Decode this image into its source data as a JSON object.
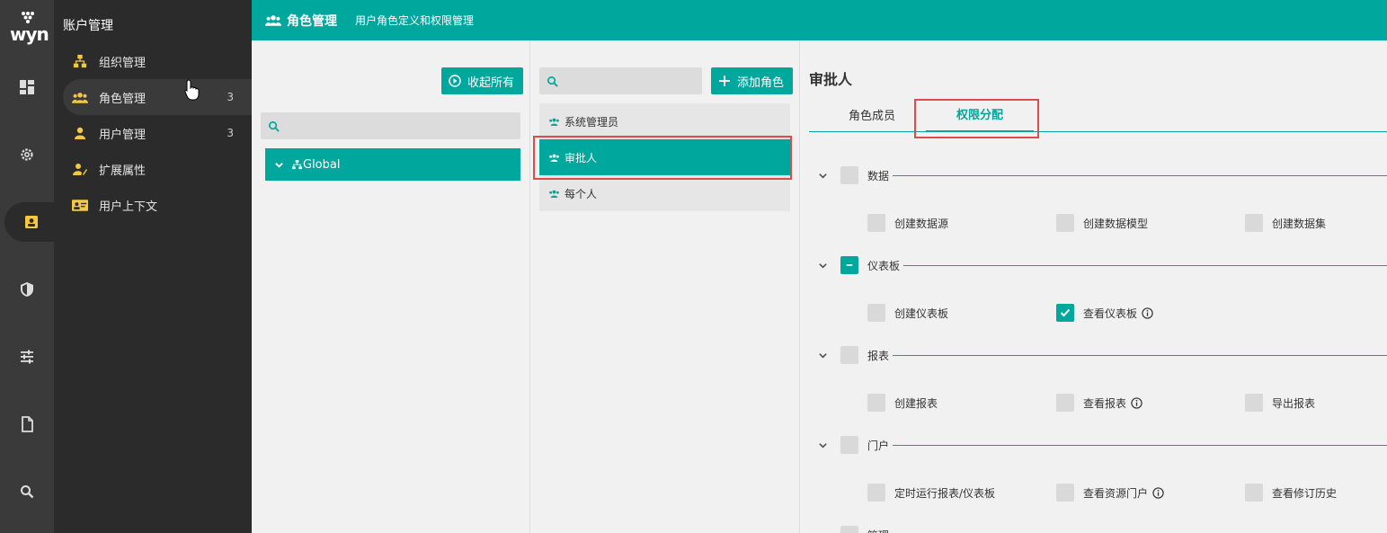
{
  "app": {
    "logo_text": "wyn"
  },
  "sidebar": {
    "title": "账户管理",
    "items": [
      {
        "label": "组织管理",
        "count": ""
      },
      {
        "label": "角色管理",
        "count": "3"
      },
      {
        "label": "用户管理",
        "count": "3"
      },
      {
        "label": "扩展属性",
        "count": ""
      },
      {
        "label": "用户上下文",
        "count": ""
      }
    ]
  },
  "header": {
    "title": "角色管理",
    "subtitle": "用户角色定义和权限管理"
  },
  "org_panel": {
    "collapse_label": "收起所有",
    "search_placeholder": "",
    "root_node": "Global"
  },
  "role_panel": {
    "add_label": "添加角色",
    "search_placeholder": "",
    "roles": [
      "系统管理员",
      "审批人",
      "每个人"
    ]
  },
  "detail": {
    "title": "审批人",
    "tabs": [
      "角色成员",
      "权限分配"
    ],
    "groups": [
      {
        "label": "数据",
        "state": "none",
        "perms": [
          {
            "label": "创建数据源",
            "checked": false,
            "info": false
          },
          {
            "label": "创建数据模型",
            "checked": false,
            "info": false
          },
          {
            "label": "创建数据集",
            "checked": false,
            "info": false
          }
        ]
      },
      {
        "label": "仪表板",
        "state": "partial",
        "perms": [
          {
            "label": "创建仪表板",
            "checked": false,
            "info": false
          },
          {
            "label": "查看仪表板",
            "checked": true,
            "info": true
          }
        ]
      },
      {
        "label": "报表",
        "state": "none",
        "perms": [
          {
            "label": "创建报表",
            "checked": false,
            "info": false
          },
          {
            "label": "查看报表",
            "checked": false,
            "info": true
          },
          {
            "label": "导出报表",
            "checked": false,
            "info": false
          }
        ]
      },
      {
        "label": "门户",
        "state": "none",
        "perms": [
          {
            "label": "定时运行报表/仪表板",
            "checked": false,
            "info": false
          },
          {
            "label": "查看资源门户",
            "checked": false,
            "info": true
          },
          {
            "label": "查看修订历史",
            "checked": false,
            "info": false
          }
        ]
      },
      {
        "label": "管理",
        "state": "none",
        "perms": []
      }
    ]
  },
  "colors": {
    "accent": "#00a79d",
    "rail": "#3a3a3a",
    "sidebar": "#2b2b2b",
    "highlight": "#e04a4a",
    "icon_yellow": "#f5c842"
  }
}
